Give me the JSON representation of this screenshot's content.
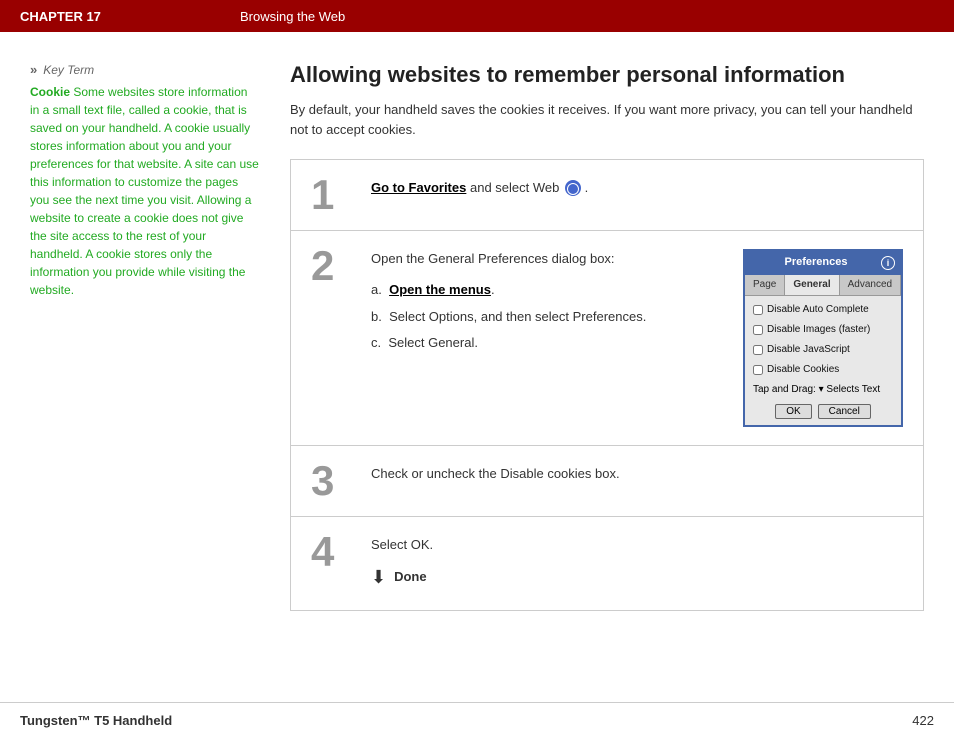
{
  "header": {
    "chapter": "CHAPTER 17",
    "title": "Browsing the Web"
  },
  "sidebar": {
    "chevrons": "»",
    "key_term_label": "Key Term",
    "keyword": "Cookie",
    "keyword_text": "  Some websites store information in a small text file, called a cookie, that is saved on your handheld. A cookie usually stores information about you and your preferences for that website. A site can use this information to customize the pages you see the next time you visit. Allowing a website to create a cookie does not give the site access to the rest of your handheld. A cookie stores only the information you provide while visiting the website."
  },
  "content": {
    "title": "Allowing websites to remember personal information",
    "intro": "By default, your handheld saves the cookies it receives. If you want more privacy, you can tell your handheld not to accept cookies.",
    "steps": [
      {
        "number": "1",
        "text_parts": {
          "link": "Go to Favorites",
          "after_link": " and select Web"
        }
      },
      {
        "number": "2",
        "intro": "Open the General Preferences dialog box:",
        "items": [
          {
            "label": "a.",
            "text": "Open the menus",
            "link": true
          },
          {
            "label": "b.",
            "text": "Select Options, and then select Preferences."
          },
          {
            "label": "c.",
            "text": "Select General."
          }
        ]
      },
      {
        "number": "3",
        "text": "Check or uncheck the Disable cookies box."
      },
      {
        "number": "4",
        "text": "Select OK.",
        "done": "Done"
      }
    ],
    "prefs_dialog": {
      "title": "Preferences",
      "tabs": [
        "Page",
        "General",
        "Advanced"
      ],
      "active_tab": "General",
      "options": [
        "Disable Auto Complete",
        "Disable Images (faster)",
        "Disable JavaScript",
        "Disable Cookies"
      ],
      "tap_drag_label": "Tap and Drag:",
      "tap_drag_value": "▾ Selects Text",
      "ok_btn": "OK",
      "cancel_btn": "Cancel"
    }
  },
  "footer": {
    "brand": "Tungsten™ T5 Handheld",
    "page": "422"
  }
}
